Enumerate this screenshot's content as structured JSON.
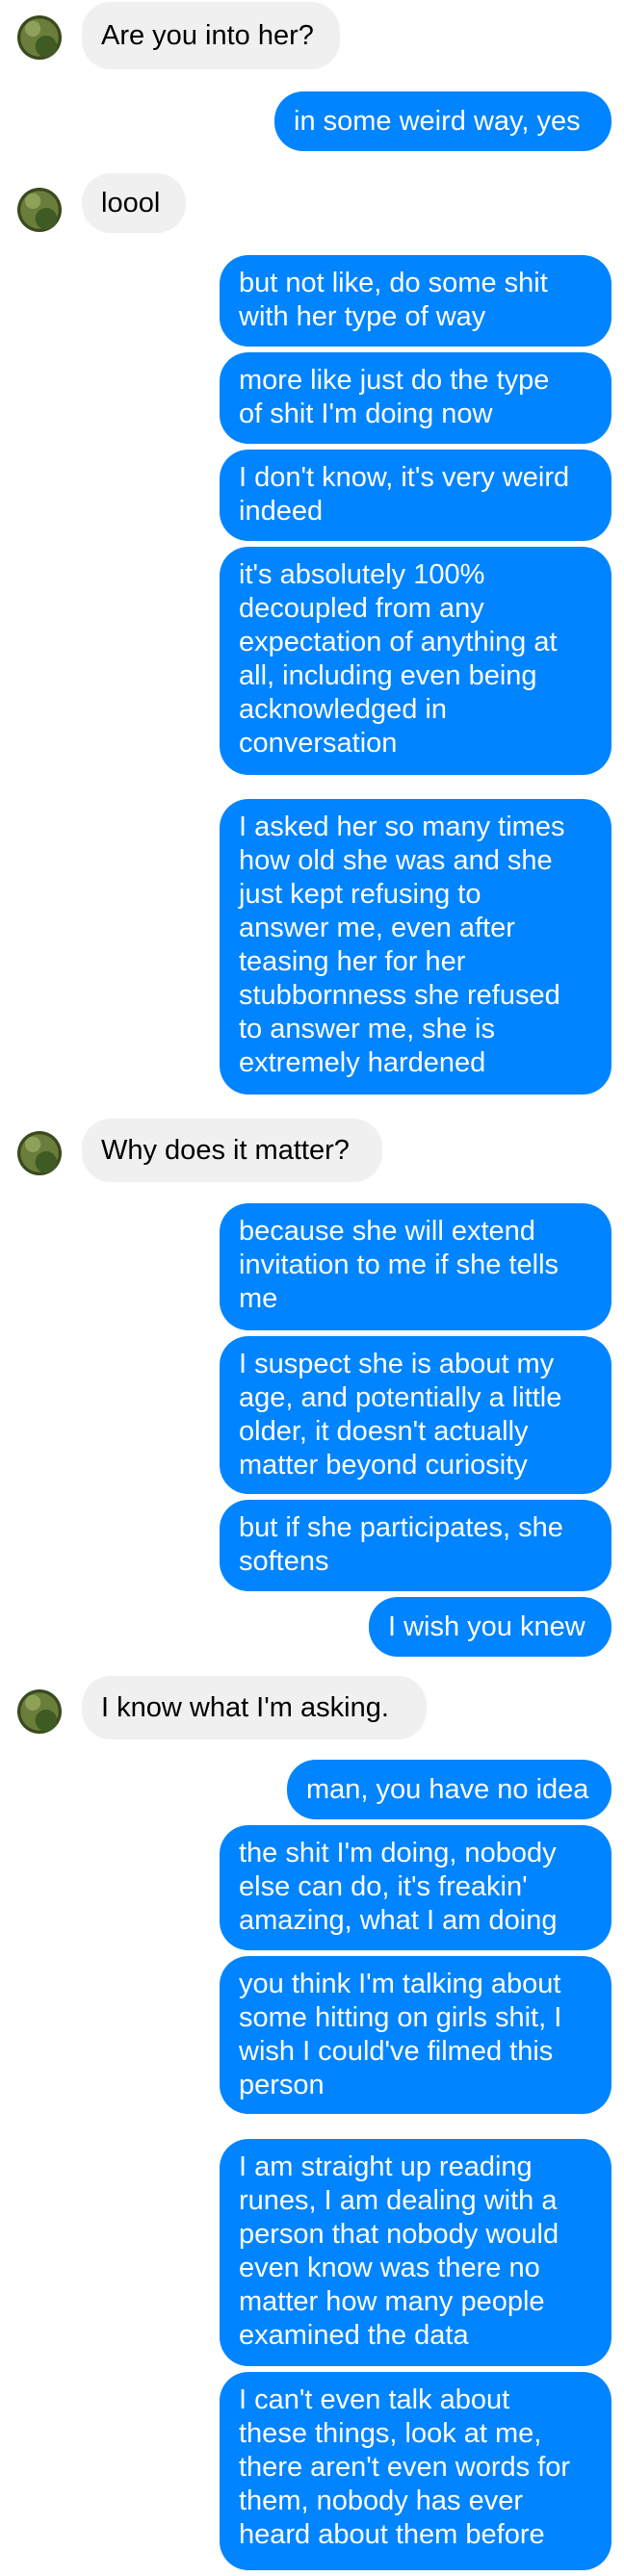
{
  "conversation": {
    "messages": [
      {
        "dir": "received",
        "text": "Are you into her?"
      },
      {
        "dir": "sent",
        "text": "in some weird way, yes"
      },
      {
        "dir": "received",
        "text": "loool"
      },
      {
        "dir": "sent",
        "text": "but not like, do some shit\nwith her type of way"
      },
      {
        "dir": "sent",
        "text": "more like just do the type\nof shit I'm doing now"
      },
      {
        "dir": "sent",
        "text": "I don't know, it's very weird\nindeed"
      },
      {
        "dir": "sent",
        "text": "it's absolutely 100%\ndecoupled from any\nexpectation of anything at\nall, including even being\nacknowledged in\nconversation"
      },
      {
        "dir": "sent",
        "text": "I asked her so many times\nhow old she was and she\njust kept refusing to\nanswer me, even after\nteasing her for her\nstubbornness she refused\nto answer me, she is\nextremely hardened"
      },
      {
        "dir": "received",
        "text": "Why does it matter?"
      },
      {
        "dir": "sent",
        "text": "because she will extend\ninvitation to me if she tells\nme"
      },
      {
        "dir": "sent",
        "text": "I suspect she is about my\nage, and potentially a little\nolder, it doesn't actually\nmatter beyond curiosity"
      },
      {
        "dir": "sent",
        "text": "but if she participates, she\nsoftens"
      },
      {
        "dir": "sent",
        "text": "I wish you knew"
      },
      {
        "dir": "received",
        "text": "I know what I'm asking."
      },
      {
        "dir": "sent",
        "text": "man, you have no idea"
      },
      {
        "dir": "sent",
        "text": "the shit I'm doing, nobody\nelse can do, it's freakin'\namazing, what I am doing"
      },
      {
        "dir": "sent",
        "text": "you think I'm talking about\nsome hitting on girls shit, I\nwish I could've filmed this\nperson"
      },
      {
        "dir": "sent",
        "text": "I am straight up reading\nrunes, I am dealing with a\nperson that nobody would\neven know was there no\nmatter how many people\nexamined the data"
      },
      {
        "dir": "sent",
        "text": "I can't even talk about\nthese things, look at me,\nthere aren't even words for\nthem, nobody has ever\nheard about them before"
      }
    ]
  },
  "colors": {
    "sent_bubble": "#0084ff",
    "received_bubble": "#f1f0f0"
  },
  "icons": {
    "avatar": "contact-avatar-photo"
  }
}
